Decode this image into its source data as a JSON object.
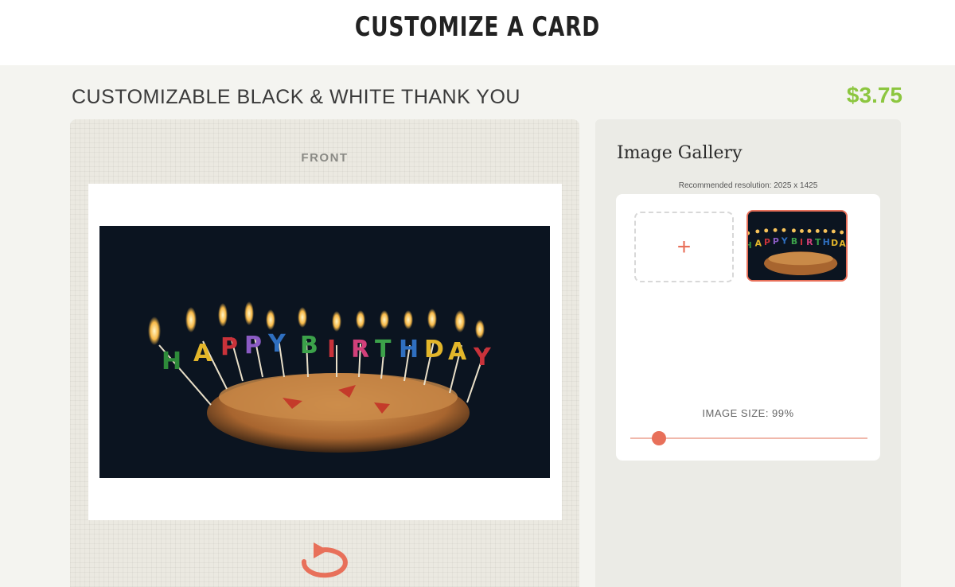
{
  "header": {
    "title": "CUSTOMIZE A CARD"
  },
  "product": {
    "title": "CUSTOMIZABLE BLACK & WHITE THANK YOU",
    "price": "$3.75"
  },
  "card": {
    "side_label": "FRONT",
    "image_icon": "birthday-cake-photo",
    "flip_icon": "rotate-icon"
  },
  "gallery": {
    "title": "Image Gallery",
    "hint": "Recommended resolution: 2025 x 1425",
    "add_label": "+",
    "image_size_label": "IMAGE SIZE: 99%",
    "image_size_value": 0.12
  },
  "colors": {
    "accent": "#e8705a",
    "price": "#8cc63f",
    "panel": "#ebe9e1"
  }
}
